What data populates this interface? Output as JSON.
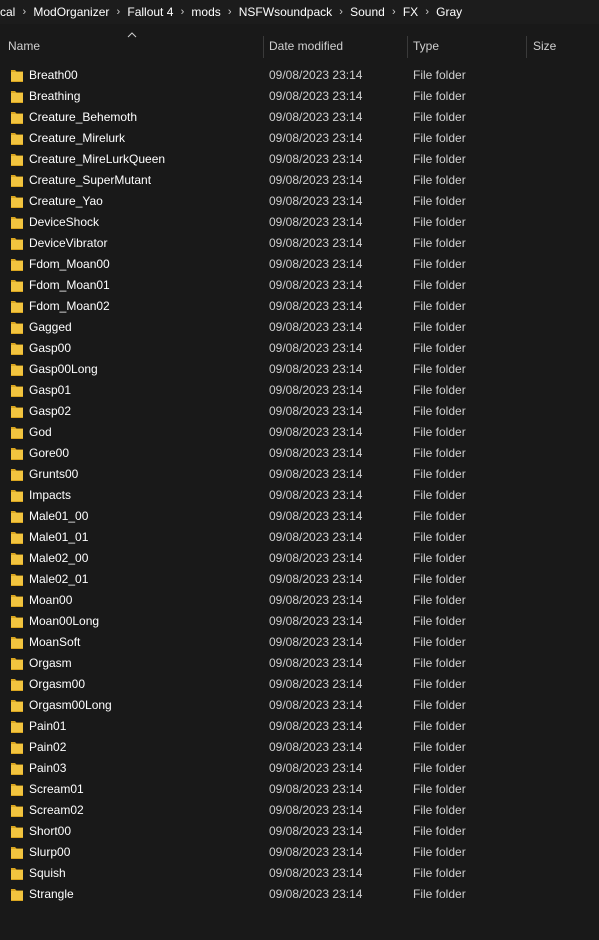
{
  "breadcrumb": [
    "cal",
    "ModOrganizer",
    "Fallout 4",
    "mods",
    "NSFWsoundpack",
    "Sound",
    "FX",
    "Gray"
  ],
  "columns": {
    "name": "Name",
    "date": "Date modified",
    "type": "Type",
    "size": "Size"
  },
  "colors": {
    "background": "#191919",
    "folder": "#f2c43f",
    "folder_dark": "#d9a520",
    "text": "#ffffff",
    "secondary_text": "#cfcfcf"
  },
  "files": [
    {
      "name": "Breath00",
      "date": "09/08/2023 23:14",
      "type": "File folder"
    },
    {
      "name": "Breathing",
      "date": "09/08/2023 23:14",
      "type": "File folder"
    },
    {
      "name": "Creature_Behemoth",
      "date": "09/08/2023 23:14",
      "type": "File folder"
    },
    {
      "name": "Creature_Mirelurk",
      "date": "09/08/2023 23:14",
      "type": "File folder"
    },
    {
      "name": "Creature_MireLurkQueen",
      "date": "09/08/2023 23:14",
      "type": "File folder"
    },
    {
      "name": "Creature_SuperMutant",
      "date": "09/08/2023 23:14",
      "type": "File folder"
    },
    {
      "name": "Creature_Yao",
      "date": "09/08/2023 23:14",
      "type": "File folder"
    },
    {
      "name": "DeviceShock",
      "date": "09/08/2023 23:14",
      "type": "File folder"
    },
    {
      "name": "DeviceVibrator",
      "date": "09/08/2023 23:14",
      "type": "File folder"
    },
    {
      "name": "Fdom_Moan00",
      "date": "09/08/2023 23:14",
      "type": "File folder"
    },
    {
      "name": "Fdom_Moan01",
      "date": "09/08/2023 23:14",
      "type": "File folder"
    },
    {
      "name": "Fdom_Moan02",
      "date": "09/08/2023 23:14",
      "type": "File folder"
    },
    {
      "name": "Gagged",
      "date": "09/08/2023 23:14",
      "type": "File folder"
    },
    {
      "name": "Gasp00",
      "date": "09/08/2023 23:14",
      "type": "File folder"
    },
    {
      "name": "Gasp00Long",
      "date": "09/08/2023 23:14",
      "type": "File folder"
    },
    {
      "name": "Gasp01",
      "date": "09/08/2023 23:14",
      "type": "File folder"
    },
    {
      "name": "Gasp02",
      "date": "09/08/2023 23:14",
      "type": "File folder"
    },
    {
      "name": "God",
      "date": "09/08/2023 23:14",
      "type": "File folder"
    },
    {
      "name": "Gore00",
      "date": "09/08/2023 23:14",
      "type": "File folder"
    },
    {
      "name": "Grunts00",
      "date": "09/08/2023 23:14",
      "type": "File folder"
    },
    {
      "name": "Impacts",
      "date": "09/08/2023 23:14",
      "type": "File folder"
    },
    {
      "name": "Male01_00",
      "date": "09/08/2023 23:14",
      "type": "File folder"
    },
    {
      "name": "Male01_01",
      "date": "09/08/2023 23:14",
      "type": "File folder"
    },
    {
      "name": "Male02_00",
      "date": "09/08/2023 23:14",
      "type": "File folder"
    },
    {
      "name": "Male02_01",
      "date": "09/08/2023 23:14",
      "type": "File folder"
    },
    {
      "name": "Moan00",
      "date": "09/08/2023 23:14",
      "type": "File folder"
    },
    {
      "name": "Moan00Long",
      "date": "09/08/2023 23:14",
      "type": "File folder"
    },
    {
      "name": "MoanSoft",
      "date": "09/08/2023 23:14",
      "type": "File folder"
    },
    {
      "name": "Orgasm",
      "date": "09/08/2023 23:14",
      "type": "File folder"
    },
    {
      "name": "Orgasm00",
      "date": "09/08/2023 23:14",
      "type": "File folder"
    },
    {
      "name": "Orgasm00Long",
      "date": "09/08/2023 23:14",
      "type": "File folder"
    },
    {
      "name": "Pain01",
      "date": "09/08/2023 23:14",
      "type": "File folder"
    },
    {
      "name": "Pain02",
      "date": "09/08/2023 23:14",
      "type": "File folder"
    },
    {
      "name": "Pain03",
      "date": "09/08/2023 23:14",
      "type": "File folder"
    },
    {
      "name": "Scream01",
      "date": "09/08/2023 23:14",
      "type": "File folder"
    },
    {
      "name": "Scream02",
      "date": "09/08/2023 23:14",
      "type": "File folder"
    },
    {
      "name": "Short00",
      "date": "09/08/2023 23:14",
      "type": "File folder"
    },
    {
      "name": "Slurp00",
      "date": "09/08/2023 23:14",
      "type": "File folder"
    },
    {
      "name": "Squish",
      "date": "09/08/2023 23:14",
      "type": "File folder"
    },
    {
      "name": "Strangle",
      "date": "09/08/2023 23:14",
      "type": "File folder"
    }
  ]
}
